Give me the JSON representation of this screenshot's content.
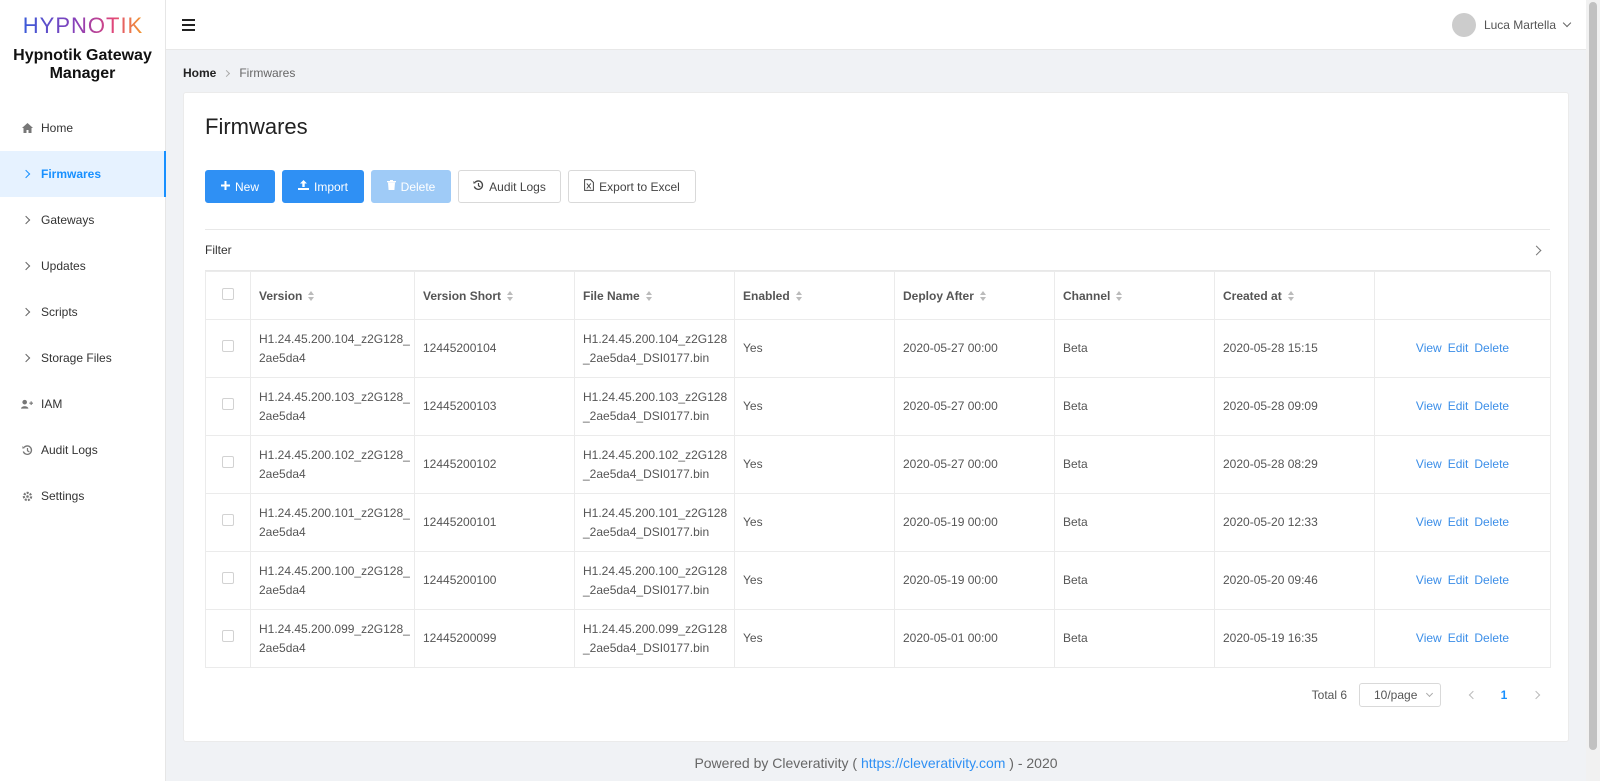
{
  "brand": {
    "logo_text": "HYPNOTIK",
    "app_name_line1": "Hypnotik Gateway",
    "app_name_line2": "Manager"
  },
  "sidebar": {
    "items": [
      {
        "label": "Home",
        "icon": "home-icon"
      },
      {
        "label": "Firmwares",
        "icon": "chevron-right-icon",
        "active": true
      },
      {
        "label": "Gateways",
        "icon": "chevron-right-icon"
      },
      {
        "label": "Updates",
        "icon": "chevron-right-icon"
      },
      {
        "label": "Scripts",
        "icon": "chevron-right-icon"
      },
      {
        "label": "Storage Files",
        "icon": "chevron-right-icon"
      },
      {
        "label": "IAM",
        "icon": "users-icon"
      },
      {
        "label": "Audit Logs",
        "icon": "history-icon"
      },
      {
        "label": "Settings",
        "icon": "gear-icon"
      }
    ]
  },
  "header": {
    "user_name": "Luca Martella"
  },
  "breadcrumb": {
    "home": "Home",
    "current": "Firmwares"
  },
  "page": {
    "title": "Firmwares"
  },
  "toolbar": {
    "new_label": "New",
    "import_label": "Import",
    "delete_label": "Delete",
    "audit_label": "Audit Logs",
    "export_label": "Export to Excel"
  },
  "filter": {
    "label": "Filter"
  },
  "table": {
    "columns": [
      "Version",
      "Version Short",
      "File Name",
      "Enabled",
      "Deploy After",
      "Channel",
      "Created at"
    ],
    "action_labels": {
      "view": "View",
      "edit": "Edit",
      "delete": "Delete"
    },
    "rows": [
      {
        "version_l1": "H1.24.45.200.104_z2G128_",
        "version_l2": "2ae5da4",
        "short": "12445200104",
        "file_l1": "H1.24.45.200.104_z2G128",
        "file_l2": "_2ae5da4_DSI0177.bin",
        "enabled": "Yes",
        "deploy": "2020-05-27 00:00",
        "channel": "Beta",
        "created": "2020-05-28 15:15"
      },
      {
        "version_l1": "H1.24.45.200.103_z2G128_",
        "version_l2": "2ae5da4",
        "short": "12445200103",
        "file_l1": "H1.24.45.200.103_z2G128",
        "file_l2": "_2ae5da4_DSI0177.bin",
        "enabled": "Yes",
        "deploy": "2020-05-27 00:00",
        "channel": "Beta",
        "created": "2020-05-28 09:09"
      },
      {
        "version_l1": "H1.24.45.200.102_z2G128_",
        "version_l2": "2ae5da4",
        "short": "12445200102",
        "file_l1": "H1.24.45.200.102_z2G128",
        "file_l2": "_2ae5da4_DSI0177.bin",
        "enabled": "Yes",
        "deploy": "2020-05-27 00:00",
        "channel": "Beta",
        "created": "2020-05-28 08:29"
      },
      {
        "version_l1": "H1.24.45.200.101_z2G128_",
        "version_l2": "2ae5da4",
        "short": "12445200101",
        "file_l1": "H1.24.45.200.101_z2G128",
        "file_l2": "_2ae5da4_DSI0177.bin",
        "enabled": "Yes",
        "deploy": "2020-05-19 00:00",
        "channel": "Beta",
        "created": "2020-05-20 12:33"
      },
      {
        "version_l1": "H1.24.45.200.100_z2G128_",
        "version_l2": "2ae5da4",
        "short": "12445200100",
        "file_l1": "H1.24.45.200.100_z2G128",
        "file_l2": "_2ae5da4_DSI0177.bin",
        "enabled": "Yes",
        "deploy": "2020-05-19 00:00",
        "channel": "Beta",
        "created": "2020-05-20 09:46"
      },
      {
        "version_l1": "H1.24.45.200.099_z2G128_",
        "version_l2": "2ae5da4",
        "short": "12445200099",
        "file_l1": "H1.24.45.200.099_z2G128",
        "file_l2": "_2ae5da4_DSI0177.bin",
        "enabled": "Yes",
        "deploy": "2020-05-01 00:00",
        "channel": "Beta",
        "created": "2020-05-19 16:35"
      }
    ]
  },
  "pagination": {
    "total": "Total 6",
    "page_size": "10/page",
    "current_page": "1"
  },
  "footer": {
    "prefix": "Powered by Cleverativity ( ",
    "link": "https://cleverativity.com",
    "suffix": " ) - 2020"
  },
  "colors": {
    "primary": "#2f90f4",
    "primary_disabled": "#9fcbf7",
    "active_bg": "#e6f2ff",
    "link": "#3b8ee8"
  }
}
